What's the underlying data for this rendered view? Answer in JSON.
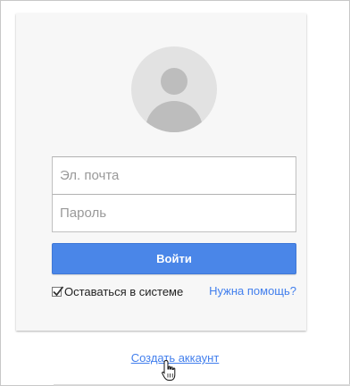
{
  "login": {
    "email_placeholder": "Эл. почта",
    "password_placeholder": "Пароль",
    "signin_label": "Войти",
    "stay_signed_in_label": "Оставаться в системе",
    "stay_signed_in_checked": true,
    "help_link": "Нужна помощь?",
    "create_account_link": "Создать аккаунт"
  },
  "colors": {
    "accent_blue": "#4a86e8",
    "link_blue": "#427fed",
    "card_bg": "#f7f7f7"
  },
  "icons": {
    "avatar": "person-avatar-icon",
    "check": "checkmark-icon",
    "cursor": "hand-pointer-icon"
  }
}
